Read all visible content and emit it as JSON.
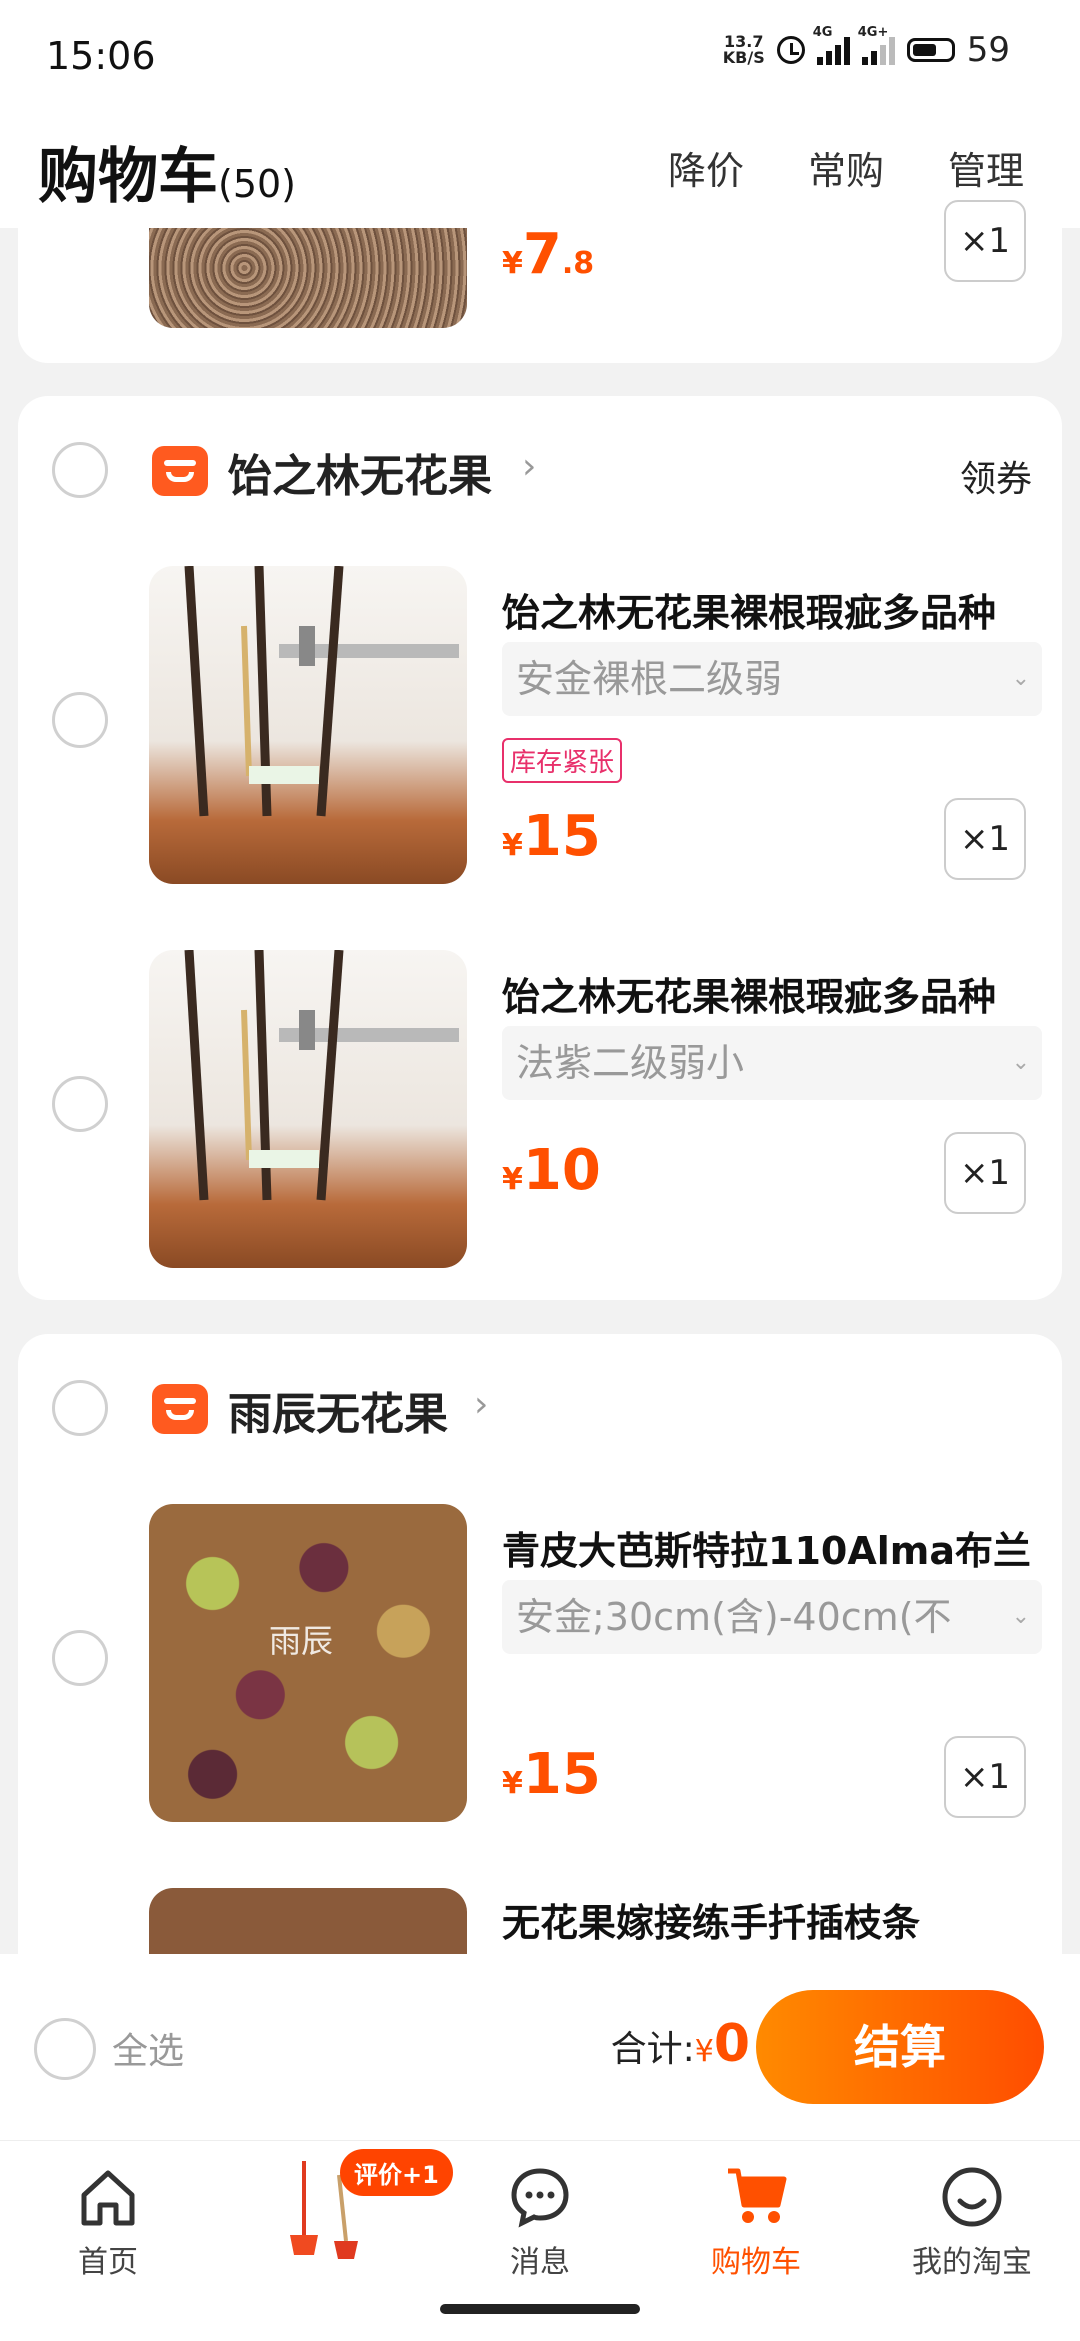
{
  "status": {
    "time": "15:06",
    "speed_top": "13.7",
    "speed_bottom": "KB/S",
    "net1": "4G",
    "net2": "4G+",
    "battery": "59"
  },
  "header": {
    "title": "购物车",
    "count": "(50)",
    "actions": [
      "降价",
      "常购",
      "管理"
    ]
  },
  "prev_item": {
    "price_int": "7",
    "price_dec": ".8",
    "qty": "×1"
  },
  "shops": [
    {
      "name": "饴之林无花果",
      "coupon": "领券",
      "items": [
        {
          "title": "饴之林无花果裸根瑕疵多品种",
          "sku": "安金裸根二级弱",
          "tag": "库存紧张",
          "price": "15",
          "qty": "×1"
        },
        {
          "title": "饴之林无花果裸根瑕疵多品种",
          "sku": "法紫二级弱小",
          "price": "10",
          "qty": "×1"
        }
      ]
    },
    {
      "name": "雨辰无花果",
      "items": [
        {
          "title": "青皮大芭斯特拉110Alma布兰",
          "sku": "安金;30cm(含)-40cm(不",
          "price": "15",
          "qty": "×1",
          "watermark": "雨辰"
        },
        {
          "title": "无花果嫁接练手扦插枝条"
        }
      ]
    }
  ],
  "bottom": {
    "select_all": "全选",
    "total_label": "合计:",
    "currency": "¥",
    "total": "0",
    "checkout": "结算"
  },
  "tabs": [
    {
      "label": "首页",
      "icon": "home-icon"
    },
    {
      "label": "",
      "icon": "product-promo-icon",
      "badge": "评价+1"
    },
    {
      "label": "消息",
      "icon": "message-icon"
    },
    {
      "label": "购物车",
      "icon": "cart-icon"
    },
    {
      "label": "我的淘宝",
      "icon": "profile-icon"
    }
  ],
  "colors": {
    "accent": "#ff5000",
    "tag": "#e8306b"
  }
}
